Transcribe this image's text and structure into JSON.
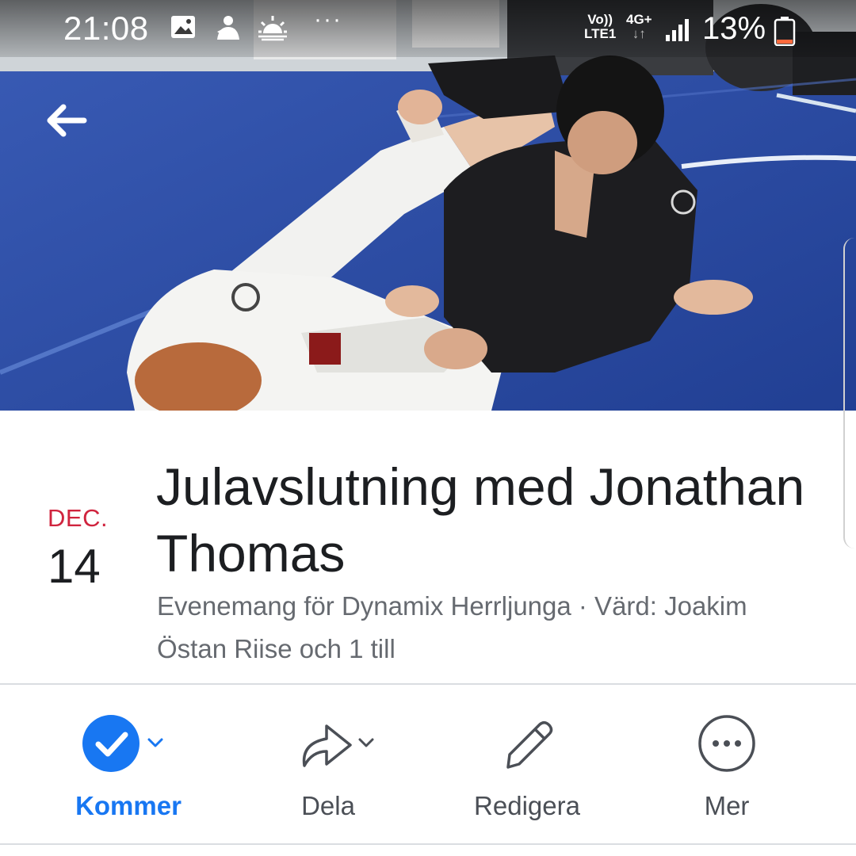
{
  "status_bar": {
    "time": "21:08",
    "network_volte_top": "Vo))",
    "network_volte_bottom": "LTE1",
    "network_type": "4G+",
    "network_arrows": "↓↑",
    "battery": "13%",
    "more_dots": "···",
    "icons": [
      "gallery-icon",
      "notification-icon",
      "weather-icon"
    ]
  },
  "navigation": {
    "back_icon": "back-arrow-icon"
  },
  "event": {
    "month": "DEC.",
    "day": "14",
    "title": "Julavslutning med Jonathan Thomas",
    "subtitle": "Evenemang för Dynamix Herrljunga · Värd: Joakim Östan Riise och 1 till"
  },
  "actions": [
    {
      "label": "Kommer",
      "icon": "check-circle-icon",
      "active": true
    },
    {
      "label": "Dela",
      "icon": "share-arrow-icon",
      "active": false
    },
    {
      "label": "Redigera",
      "icon": "pencil-icon",
      "active": false
    },
    {
      "label": "Mer",
      "icon": "more-circle-icon",
      "active": false
    }
  ],
  "colors": {
    "accent": "#1877f2",
    "date_month": "#d0243e",
    "text_primary": "#1c1e21",
    "text_secondary": "#666a70",
    "mat": "#2c4fa8"
  }
}
